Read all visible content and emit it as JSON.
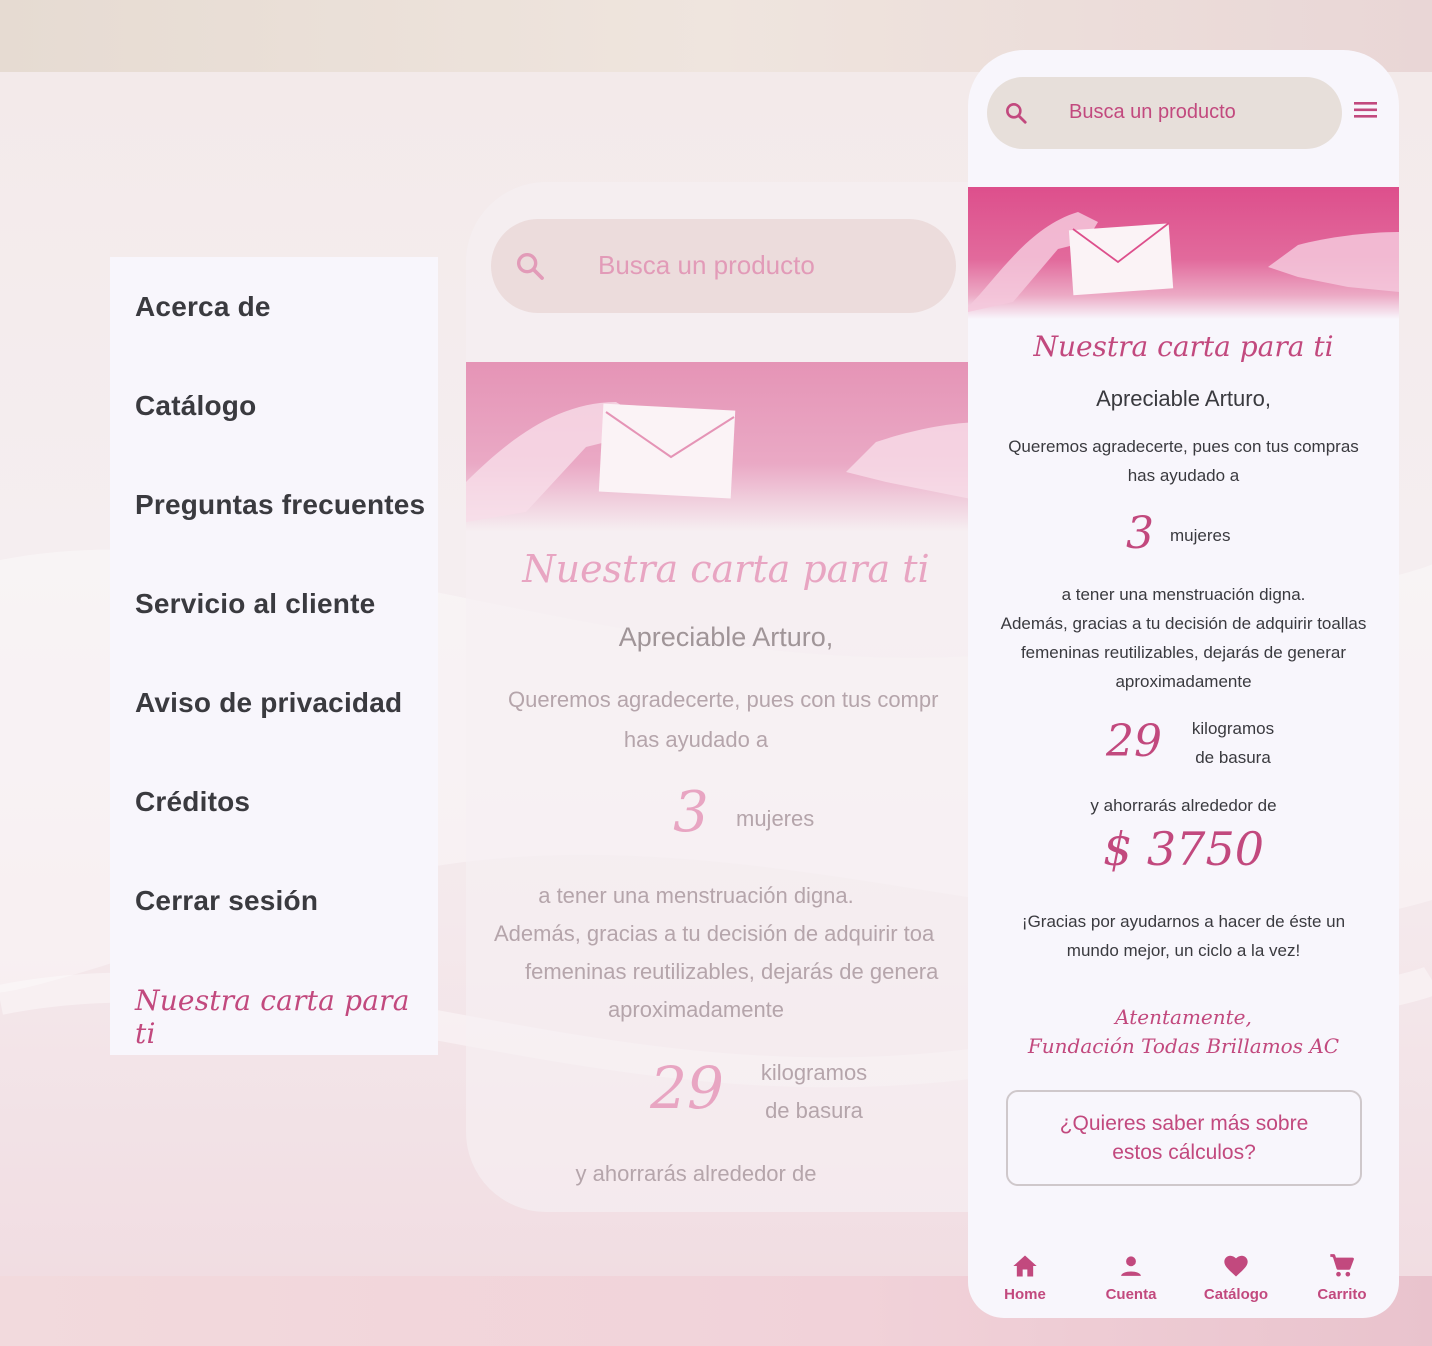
{
  "menu": {
    "items": [
      {
        "label": "Acerca de"
      },
      {
        "label": "Catálogo"
      },
      {
        "label": "Preguntas frecuentes"
      },
      {
        "label": "Servicio al cliente"
      },
      {
        "label": "Aviso de privacidad"
      },
      {
        "label": "Créditos"
      },
      {
        "label": "Cerrar sesión"
      }
    ],
    "active_label": "Nuestra carta para ti"
  },
  "ghost": {
    "search_placeholder": "Busca un producto",
    "title": "Nuestra carta para ti",
    "greeting": "Apreciable Arturo,",
    "intro_line1": "Queremos agradecerte, pues con tus compr",
    "intro_line2": "has ayudado a",
    "women_count": "3",
    "women_label": "mujeres",
    "line_a": "a tener una menstruación digna.",
    "line_b": "Además, gracias a tu decisión de adquirir toa",
    "line_c": "femeninas reutilizables, dejarás de genera",
    "line_d": "aproximadamente",
    "kg_count": "29",
    "kg_label1": "kilogramos",
    "kg_label2": "de basura",
    "save_line": "y ahorrarás alrededor de"
  },
  "phone": {
    "search_placeholder": "Busca un producto",
    "title": "Nuestra carta para ti",
    "greeting": "Apreciable Arturo,",
    "intro_line1": "Queremos agradecerte, pues con tus compras",
    "intro_line2": "has ayudado a",
    "women_count": "3",
    "women_label": "mujeres",
    "line_a": "a tener una menstruación digna.",
    "line_b": "Además, gracias a tu decisión de adquirir toallas",
    "line_c": "femeninas reutilizables, dejarás de generar",
    "line_d": "aproximadamente",
    "kg_count": "29",
    "kg_label1": "kilogramos",
    "kg_label2": "de basura",
    "save_line": "y ahorrarás alrededor de",
    "money": "$ 3750",
    "thanks_line1": "¡Gracias por ayudarnos a hacer de éste un",
    "thanks_line2": "mundo mejor, un ciclo a la vez!",
    "sign_line1": "Atentamente,",
    "sign_line2": "Fundación Todas Brillamos AC",
    "more_button": "¿Quieres saber más sobre estos cálculos?",
    "nav": [
      {
        "label": "Home",
        "icon": "home-icon"
      },
      {
        "label": "Cuenta",
        "icon": "person-icon"
      },
      {
        "label": "Catálogo",
        "icon": "heart-icon"
      },
      {
        "label": "Carrito",
        "icon": "cart-icon"
      }
    ]
  },
  "colors": {
    "accent": "#c2497e",
    "surface": "#f8f6fc",
    "search_bg": "#e7dfda",
    "text": "#3a3a3f"
  }
}
